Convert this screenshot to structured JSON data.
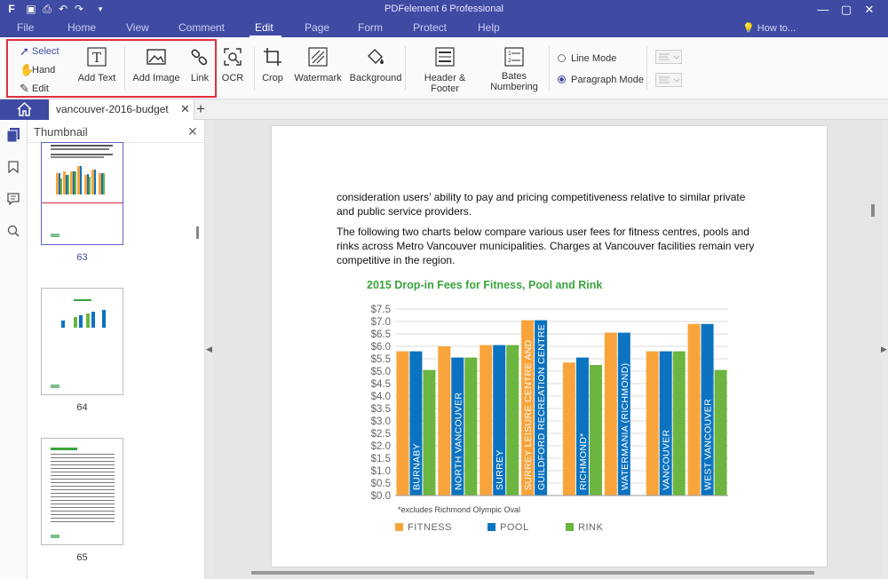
{
  "app": {
    "title": "PDFelement 6 Professional"
  },
  "menu": {
    "items": [
      "File",
      "Home",
      "View",
      "Comment",
      "Edit",
      "Page",
      "Form",
      "Protect",
      "Help"
    ],
    "active": "Edit",
    "howto": "How to..."
  },
  "ribbon": {
    "select": "Select",
    "hand": "Hand",
    "edit": "Edit",
    "add_text": "Add Text",
    "add_image": "Add Image",
    "link": "Link",
    "ocr": "OCR",
    "crop": "Crop",
    "watermark": "Watermark",
    "background": "Background",
    "header_footer": "Header & Footer",
    "bates_line1": "Bates",
    "bates_line2": "Numbering",
    "line_mode": "Line Mode",
    "paragraph_mode": "Paragraph Mode",
    "selected_mode": "paragraph"
  },
  "tabs": {
    "doc_name": "vancouver-2016-budget"
  },
  "thumbnail": {
    "header": "Thumbnail",
    "pages": [
      "63",
      "64",
      "65"
    ],
    "active_page": "63"
  },
  "document": {
    "para1": "consideration users’ ability to pay and pricing competitiveness relative to similar private and public service providers.",
    "para2": "The following two charts below compare various user fees for fitness centres, pools and rinks across Metro Vancouver municipalities. Charges at Vancouver facilities remain very competitive in the region.",
    "footnote": "*excludes Richmond Olympic Oval"
  },
  "chart_data": {
    "type": "bar",
    "title": "2015 Drop-in Fees for Fitness, Pool and Rink",
    "categories": [
      "BURNABY",
      "NORTH VANCOUVER",
      "SURREY",
      "SURREY LEISURE CENTRE AND GUILDFORD RECREATION CENTRE",
      "RICHMOND*",
      "WATERMANIA (RICHMOND)",
      "VANCOUVER",
      "WEST VANCOUVER"
    ],
    "category_lines": [
      [
        "BURNABY"
      ],
      [
        "NORTH VANCOUVER"
      ],
      [
        "SURREY"
      ],
      [
        "SURREY LEISURE CENTRE AND",
        "GUILDFORD RECREATION CENTRE"
      ],
      [
        "RICHMOND*"
      ],
      [
        "WATERMANIA (RICHMOND)"
      ],
      [
        "VANCOUVER"
      ],
      [
        "WEST VANCOUVER"
      ]
    ],
    "series": [
      {
        "name": "FITNESS",
        "color": "#f9a43b",
        "values": [
          5.8,
          6.0,
          6.05,
          7.05,
          5.35,
          6.55,
          5.8,
          6.9
        ]
      },
      {
        "name": "POOL",
        "color": "#0b73c0",
        "values": [
          5.8,
          5.55,
          6.05,
          7.05,
          5.55,
          6.55,
          5.8,
          6.9
        ]
      },
      {
        "name": "RINK",
        "color": "#6bb540",
        "values": [
          5.05,
          5.55,
          6.05,
          null,
          5.25,
          null,
          5.8,
          5.05
        ]
      }
    ],
    "ylim": [
      0,
      7.5
    ],
    "yticks": [
      "$0.0",
      "$0.5",
      "$1.0",
      "$1.5",
      "$2.0",
      "$2.5",
      "$3.0",
      "$3.5",
      "$4.0",
      "$4.5",
      "$5.0",
      "$5.5",
      "$6.0",
      "$6.5",
      "$7.0",
      "$7.5"
    ],
    "ytick_values": [
      0,
      0.5,
      1.0,
      1.5,
      2.0,
      2.5,
      3.0,
      3.5,
      4.0,
      4.5,
      5.0,
      5.5,
      6.0,
      6.5,
      7.0,
      7.5
    ],
    "grid": true,
    "legend": "bottom"
  }
}
